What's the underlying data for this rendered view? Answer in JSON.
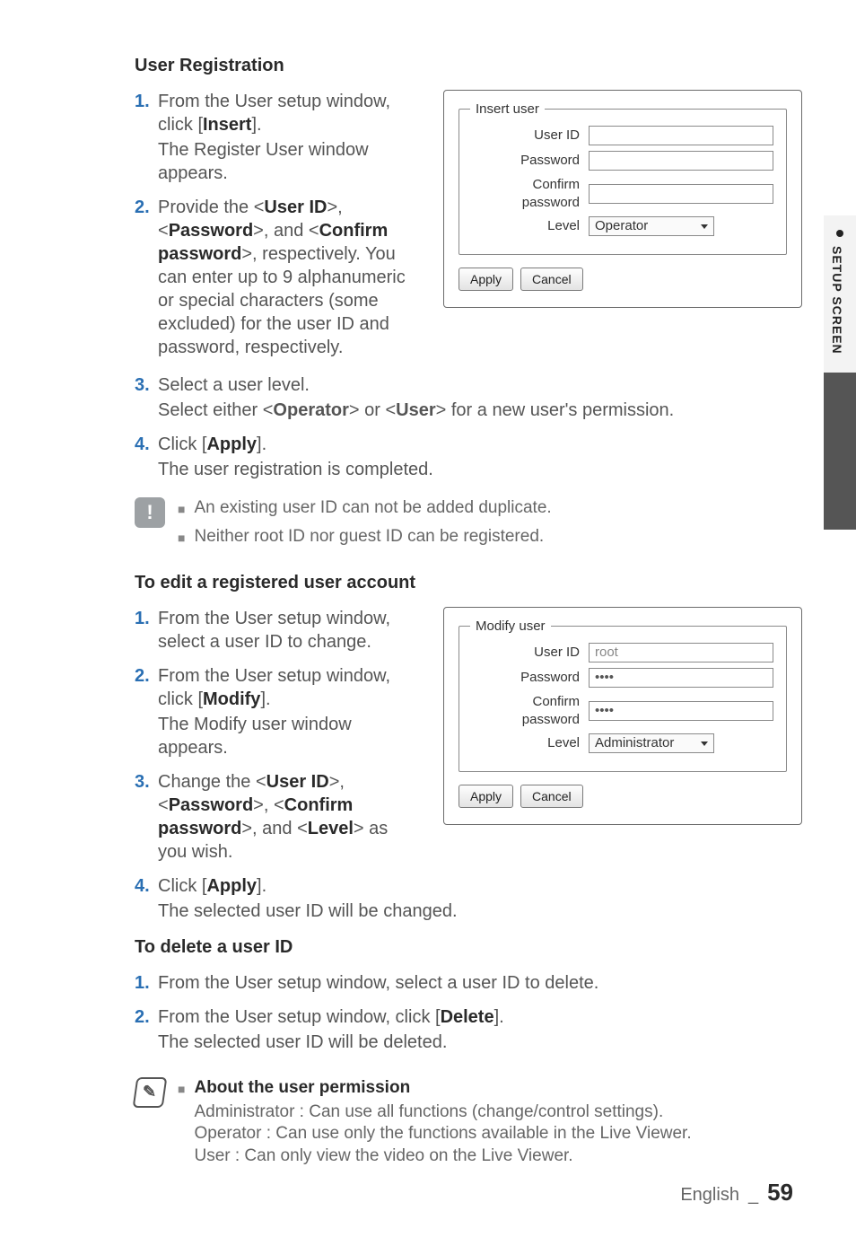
{
  "sidetab": {
    "label": "SETUP SCREEN"
  },
  "sec_user_reg": {
    "title": "User Registration",
    "steps": [
      {
        "text": "From the User setup window, click [",
        "bold": "Insert",
        "after": "].",
        "sub": "The Register User window appears."
      },
      {
        "text": "Provide the <",
        "bold": "User ID",
        "mid1": ">, <",
        "bold2": "Password",
        "mid2": ">, and <",
        "bold3": "Confirm password",
        "after": ">, respectively. You can enter up to 9 alphanumeric or special characters (some excluded) for the user ID and password, respectively."
      },
      {
        "text": "Select a user level.",
        "sub": "Select either <",
        "sub_b1": "Operator",
        "sub_mid": "> or <",
        "sub_b2": "User",
        "sub_after": "> for a new user's permission."
      },
      {
        "text": "Click [",
        "bold": "Apply",
        "after": "].",
        "sub": "The user registration is completed."
      }
    ]
  },
  "warn": {
    "line1": "An existing user ID can not be added duplicate.",
    "line2": "Neither root ID nor guest ID can be registered."
  },
  "sec_edit": {
    "title": "To edit a registered user account",
    "steps": [
      {
        "text": "From the User setup window, select a user ID to change."
      },
      {
        "text": "From the User setup window, click [",
        "bold": "Modify",
        "after": "].",
        "sub": "The Modify user window appears."
      },
      {
        "text": "Change the <",
        "bold": "User ID",
        "mid1": ">, <",
        "bold2": "Password",
        "mid2": ">, <",
        "bold3": "Confirm password",
        "mid3": ">, and <",
        "bold4": "Level",
        "after": "> as you wish."
      },
      {
        "text": "Click [",
        "bold": "Apply",
        "after": "].",
        "sub": "The selected user ID will be changed."
      }
    ]
  },
  "sec_delete": {
    "title": "To delete a user ID",
    "steps": [
      {
        "text": "From the User setup window, select a user ID to delete."
      },
      {
        "text": "From the User setup window, click [",
        "bold": "Delete",
        "after": "].",
        "sub": "The selected user ID will be deleted."
      }
    ]
  },
  "perm": {
    "title": "About the user permission",
    "admin": "Administrator : Can use all functions (change/control settings).",
    "oper": "Operator : Can use only the functions available in the Live Viewer.",
    "user": "User : Can only view the video on the Live Viewer."
  },
  "dlg_insert": {
    "legend": "Insert user",
    "labels": {
      "userid": "User ID",
      "pwd": "Password",
      "cpwd": "Confirm password",
      "level": "Level"
    },
    "level_value": "Operator",
    "apply": "Apply",
    "cancel": "Cancel"
  },
  "dlg_modify": {
    "legend": "Modify user",
    "labels": {
      "userid": "User ID",
      "pwd": "Password",
      "cpwd": "Confirm password",
      "level": "Level"
    },
    "userid_value": "root",
    "pwd_value": "••••",
    "cpwd_value": "••••",
    "level_value": "Administrator",
    "apply": "Apply",
    "cancel": "Cancel"
  },
  "footer": {
    "lang": "English",
    "sep": "_",
    "page": "59"
  }
}
